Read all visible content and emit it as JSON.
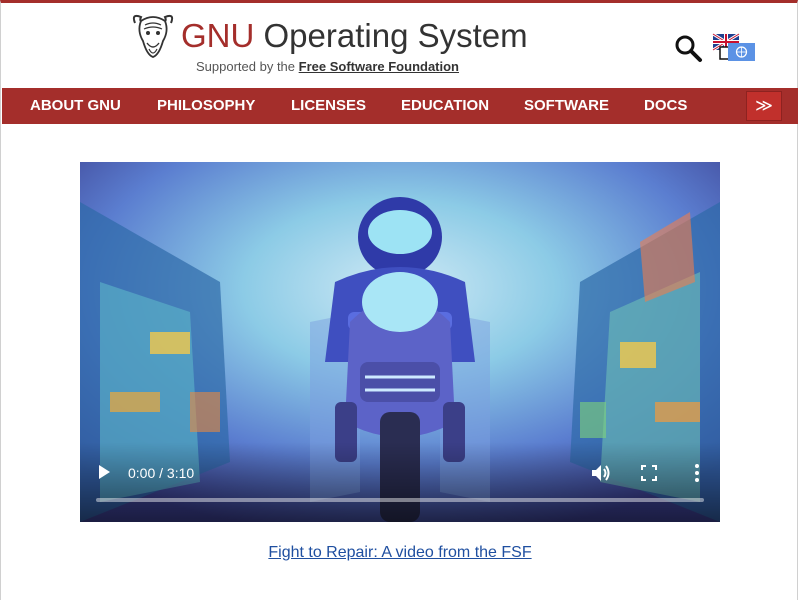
{
  "header": {
    "title_gnu": "GNU",
    "title_rest": "Operating System",
    "supported_prefix": "Supported by the",
    "supported_link": "Free Software Foundation",
    "search_icon": "magnifier-icon",
    "language_icon": "language-flags-icon"
  },
  "nav": {
    "items": [
      {
        "label": "ABOUT GNU"
      },
      {
        "label": "PHILOSOPHY"
      },
      {
        "label": "LICENSES"
      },
      {
        "label": "EDUCATION"
      },
      {
        "label": "SOFTWARE"
      },
      {
        "label": "DOCS"
      }
    ],
    "more_label": "≫"
  },
  "video": {
    "time": "0:00 / 3:10",
    "progress": 0,
    "caption": "Fight to Repair: A video from the FSF"
  },
  "colors": {
    "brand_red": "#a42e2b",
    "link_blue": "#1f4fa0"
  }
}
